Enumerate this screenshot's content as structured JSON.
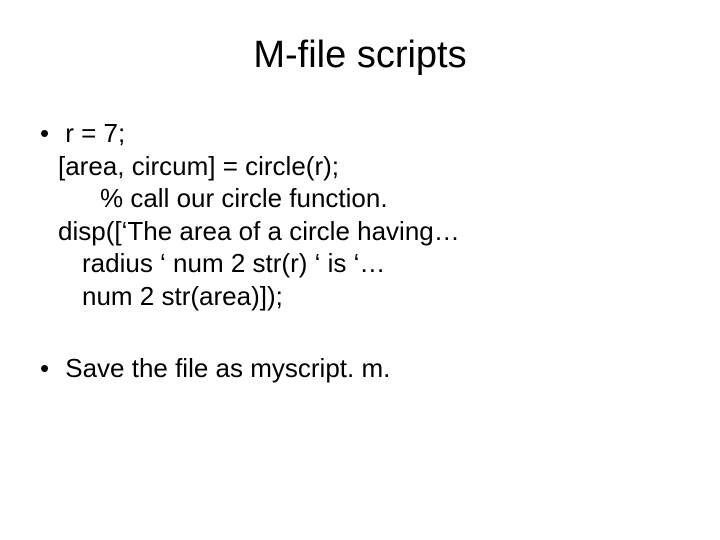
{
  "title": "M-file scripts",
  "bullet1": {
    "line1": "r = 7;",
    "line2": "[area, circum] = circle(r);",
    "line3": "% call our circle function.",
    "line4": "disp([‘The area of a circle having…",
    "line5": "radius ‘ num 2 str(r) ‘ is ‘…",
    "line6": "num 2 str(area)]);"
  },
  "bullet2": {
    "line1": "Save the file as myscript. m."
  }
}
